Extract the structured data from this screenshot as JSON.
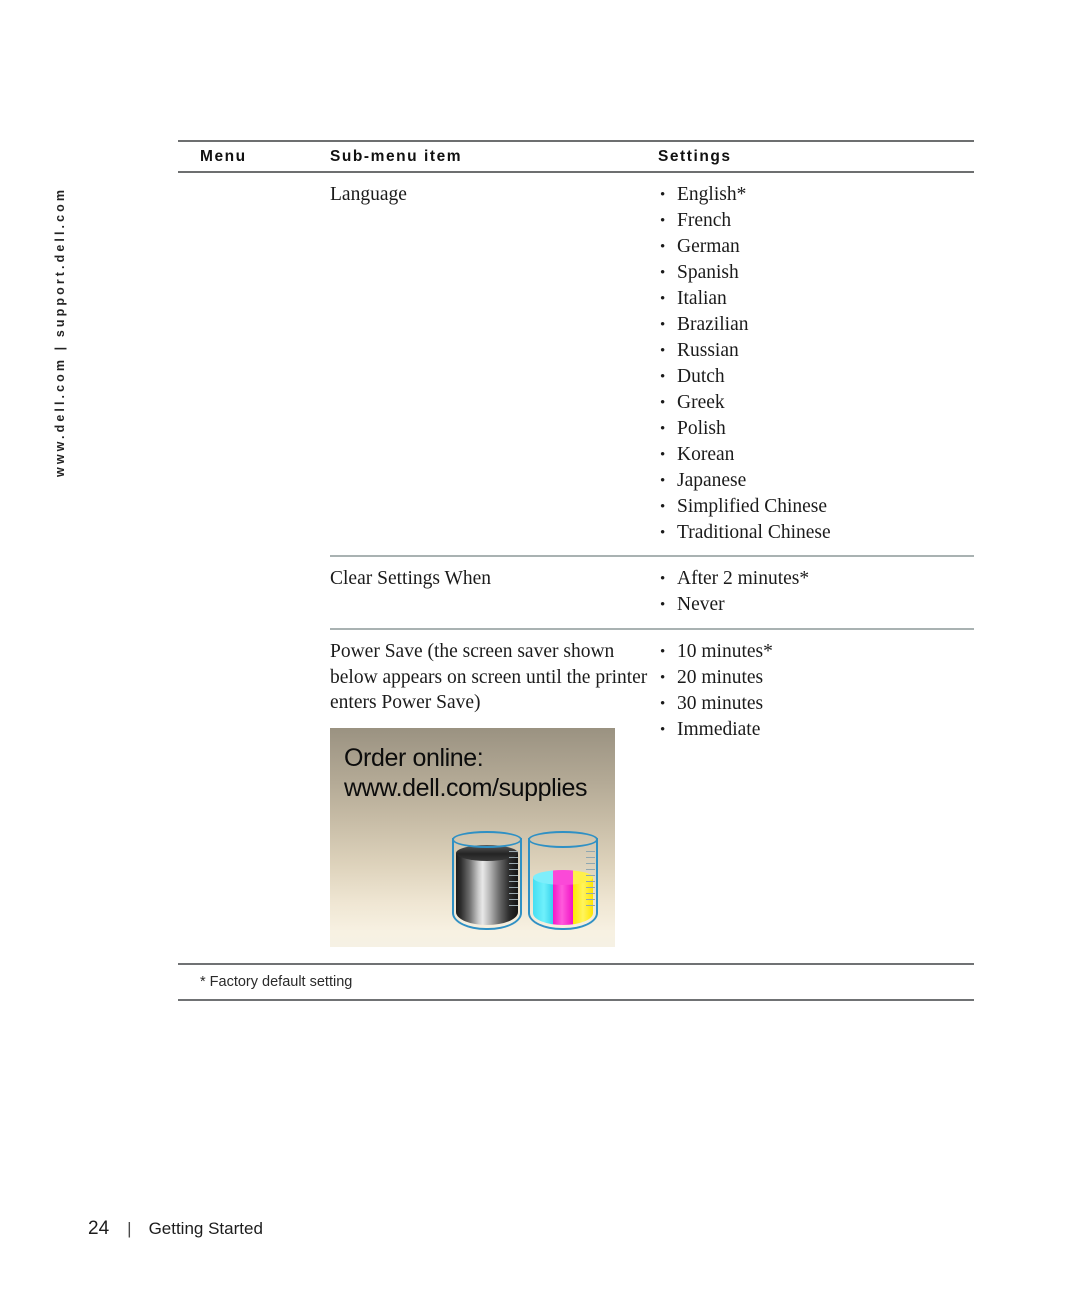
{
  "side_rail": {
    "text": "www.dell.com | support.dell.com"
  },
  "table": {
    "headers": {
      "menu": "Menu",
      "sub_menu_item": "Sub-menu item",
      "settings": "Settings"
    },
    "rows": [
      {
        "menu": "",
        "sub_menu_item": "Language",
        "settings": [
          "English*",
          "French",
          "German",
          "Spanish",
          "Italian",
          "Brazilian",
          "Russian",
          "Dutch",
          "Greek",
          "Polish",
          "Korean",
          "Japanese",
          "Simplified Chinese",
          "Traditional Chinese"
        ]
      },
      {
        "menu": "",
        "sub_menu_item": "Clear Settings When",
        "settings": [
          "After 2 minutes*",
          "Never"
        ]
      },
      {
        "menu": "",
        "sub_menu_item": "Power Save (the screen saver shown below appears on screen until the printer enters Power Save)",
        "settings": [
          "10 minutes*",
          "20 minutes",
          "30 minutes",
          "Immediate"
        ]
      }
    ],
    "footnote": "* Factory default setting"
  },
  "screensaver": {
    "line1": "Order online:",
    "line2": "www.dell.com/supplies",
    "black_beaker": "black-ink-beaker-icon",
    "color_beaker": "color-ink-beaker-icon",
    "colors": {
      "cyan": "#46dff2",
      "magenta": "#f318c9",
      "yellow": "#ffe800",
      "glass_outline": "#2f90c4"
    }
  },
  "footer": {
    "page_number": "24",
    "separator": "|",
    "section": "Getting Started"
  }
}
